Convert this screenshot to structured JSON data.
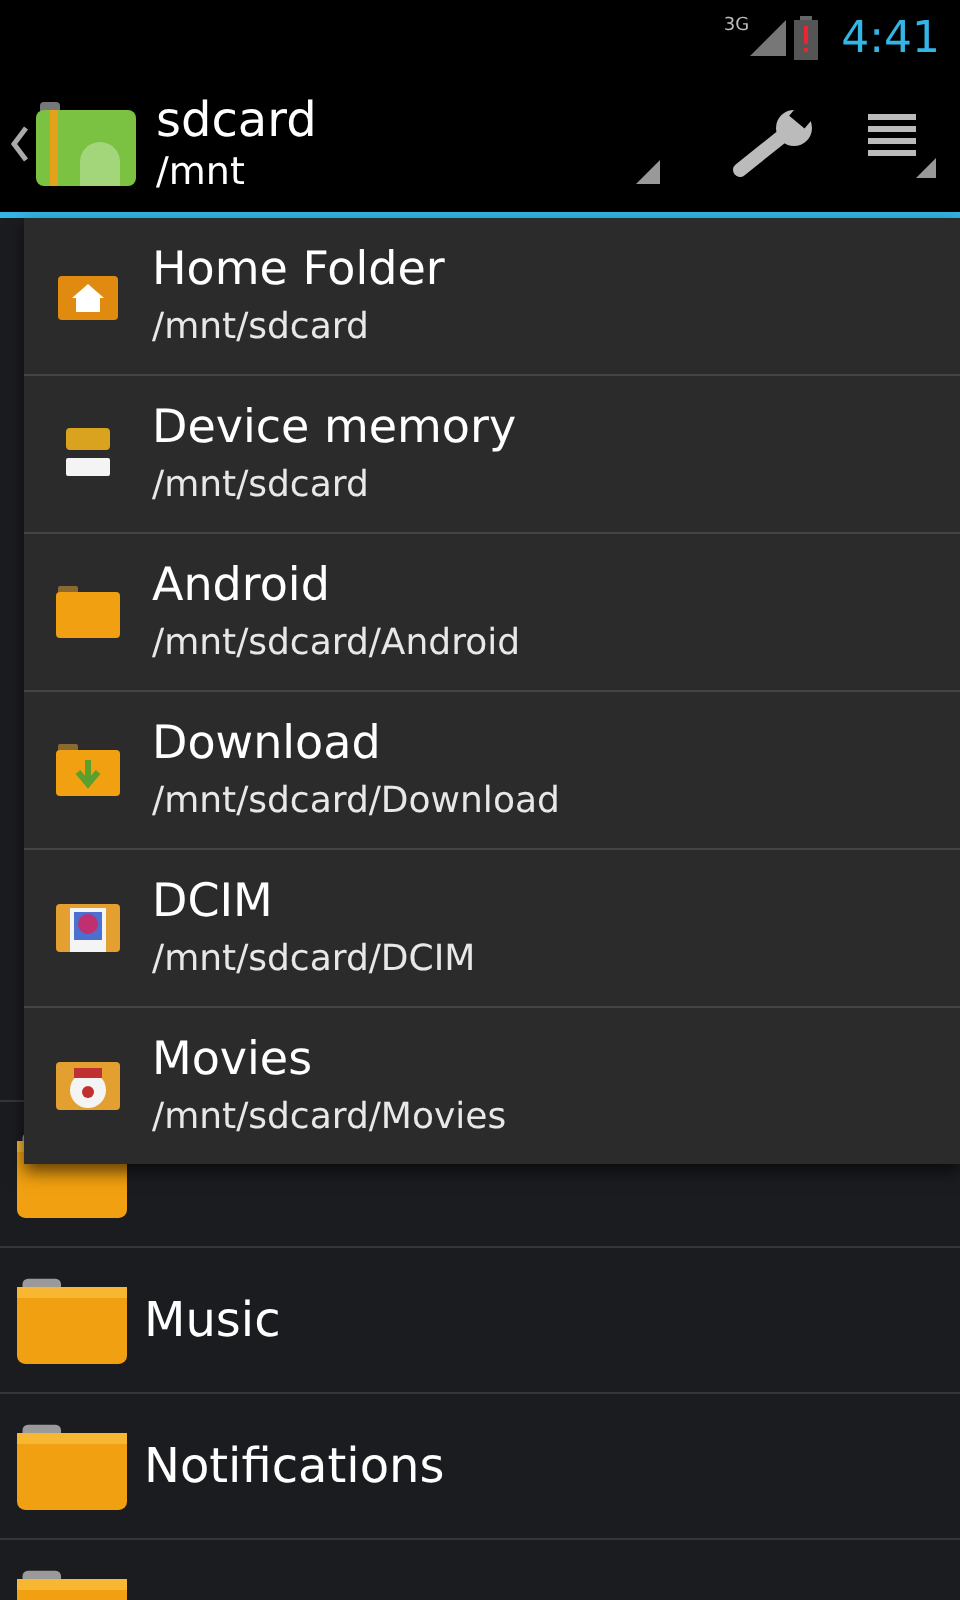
{
  "status_bar": {
    "network": "3G",
    "time": "4:41"
  },
  "action_bar": {
    "title": "sdcard",
    "path": "/mnt"
  },
  "list": {
    "items": [
      {
        "kind": "partial"
      },
      {
        "kind": "folder",
        "name": "Music"
      },
      {
        "kind": "folder",
        "name": "Notifications"
      },
      {
        "kind": "partial"
      }
    ]
  },
  "bookmarks_menu": {
    "items": [
      {
        "kind": "home",
        "name": "Home Folder",
        "path": "/mnt/sdcard"
      },
      {
        "kind": "device",
        "name": "Device memory",
        "path": "/mnt/sdcard"
      },
      {
        "kind": "folder",
        "name": "Android",
        "path": "/mnt/sdcard/Android"
      },
      {
        "kind": "download",
        "name": "Download",
        "path": "/mnt/sdcard/Download"
      },
      {
        "kind": "photos",
        "name": "DCIM",
        "path": "/mnt/sdcard/DCIM"
      },
      {
        "kind": "movies",
        "name": "Movies",
        "path": "/mnt/sdcard/Movies"
      }
    ]
  }
}
